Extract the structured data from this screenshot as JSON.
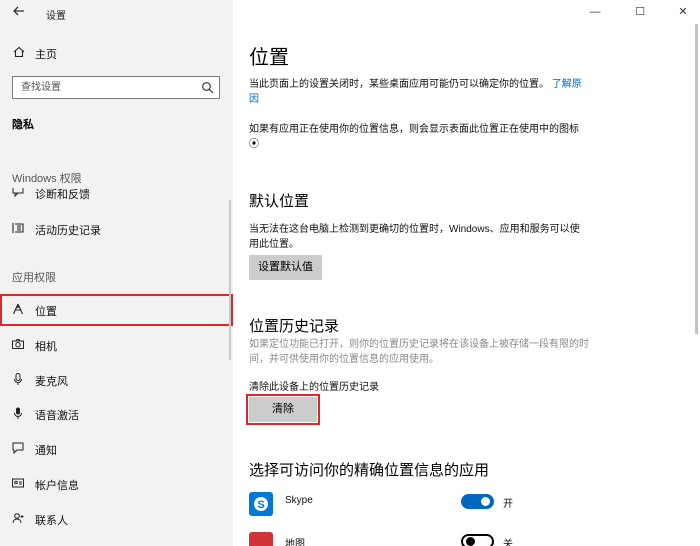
{
  "window": {
    "back_icon": "arrow-left-icon",
    "title": "设置",
    "controls": {
      "minimize": "—",
      "maximize": "☐",
      "close": "✕"
    }
  },
  "sidebar": {
    "home_label": "主页",
    "search_placeholder": "查找设置",
    "section_title": "隐私",
    "windows_group_label": "Windows 权限",
    "windows_items": [
      {
        "label": "诊断和反馈",
        "icon": "feedback-icon"
      },
      {
        "label": "活动历史记录",
        "icon": "activity-history-icon"
      }
    ],
    "app_group_label": "应用权限",
    "app_items": [
      {
        "label": "位置",
        "icon": "location-icon",
        "selected": true
      },
      {
        "label": "相机",
        "icon": "camera-icon"
      },
      {
        "label": "麦克风",
        "icon": "microphone-icon"
      },
      {
        "label": "语音激活",
        "icon": "voice-activation-icon"
      },
      {
        "label": "通知",
        "icon": "notification-icon"
      },
      {
        "label": "帐户信息",
        "icon": "account-info-icon"
      },
      {
        "label": "联系人",
        "icon": "contacts-icon"
      }
    ],
    "accent_selected": "#e0262b"
  },
  "main": {
    "title": "位置",
    "intro_text": "当此页面上的设置关闭时，某些桌面应用可能仍可以确定你的位置。",
    "intro_link": "了解原因",
    "indicator_text": "如果有应用正在使用你的位置信息，则会显示表面此位置正在使用中的图标",
    "indicator_symbol": "⦿",
    "default_location": {
      "heading": "默认位置",
      "description": "当无法在这台电脑上检测到更确切的位置时，Windows、应用和服务可以使用此位置。",
      "button": "设置默认值"
    },
    "history": {
      "heading": "位置历史记录",
      "description": "如果定位功能已打开，则你的位置历史记录将在该设备上被存储一段有限的时间，并可供使用你的位置信息的应用使用。",
      "clear_label": "清除此设备上的位置历史记录",
      "clear_button": "清除"
    },
    "apps": {
      "heading": "选择可访问你的精确位置信息的应用",
      "items": [
        {
          "name": "Skype",
          "state": "开",
          "on": true,
          "icon_color": "#0078d4"
        },
        {
          "name": "地图",
          "state": "关",
          "on": false,
          "icon_color": "#d13438"
        }
      ]
    },
    "link_color": "#0067c0"
  }
}
